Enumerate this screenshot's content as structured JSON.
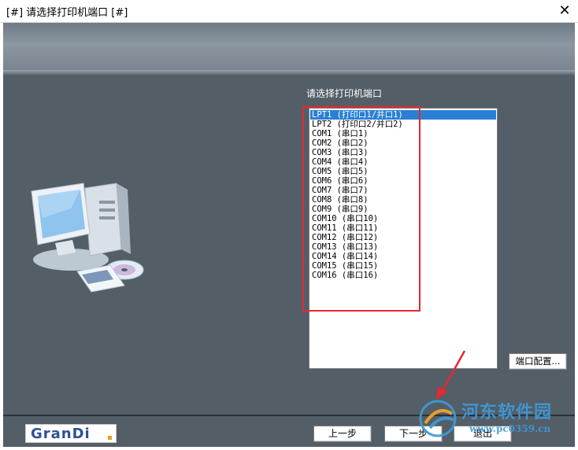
{
  "window": {
    "title": "[#] 请选择打印机端口 [#]",
    "close_glyph": "✕"
  },
  "main": {
    "port_label": "请选择打印机端口",
    "ports": [
      "LPT1 (打印口1/并口1)",
      "LPT2 (打印口2/并口2)",
      "COM1 (串口1)",
      "COM2 (串口2)",
      "COM3 (串口3)",
      "COM4 (串口4)",
      "COM5 (串口5)",
      "COM6 (串口6)",
      "COM7 (串口7)",
      "COM8 (串口8)",
      "COM9 (串口9)",
      "COM10 (串口10)",
      "COM11 (串口11)",
      "COM12 (串口12)",
      "COM13 (串口13)",
      "COM14 (串口14)",
      "COM15 (串口15)",
      "COM16 (串口16)"
    ],
    "selected_port": "LPT1 (打印口1/并口1)",
    "port_config_label": "端口配置..."
  },
  "footer": {
    "logo": "GranDi",
    "prev_label": "上一步",
    "next_label": "下一步",
    "exit_label": "退出"
  },
  "watermark": {
    "title": "河东软件园",
    "url": "www.pc0359.cn"
  },
  "colors": {
    "panel": "#535e67",
    "selection": "#2a7fd4",
    "highlight": "#e8272f",
    "watermark": "#3e9ad8"
  }
}
